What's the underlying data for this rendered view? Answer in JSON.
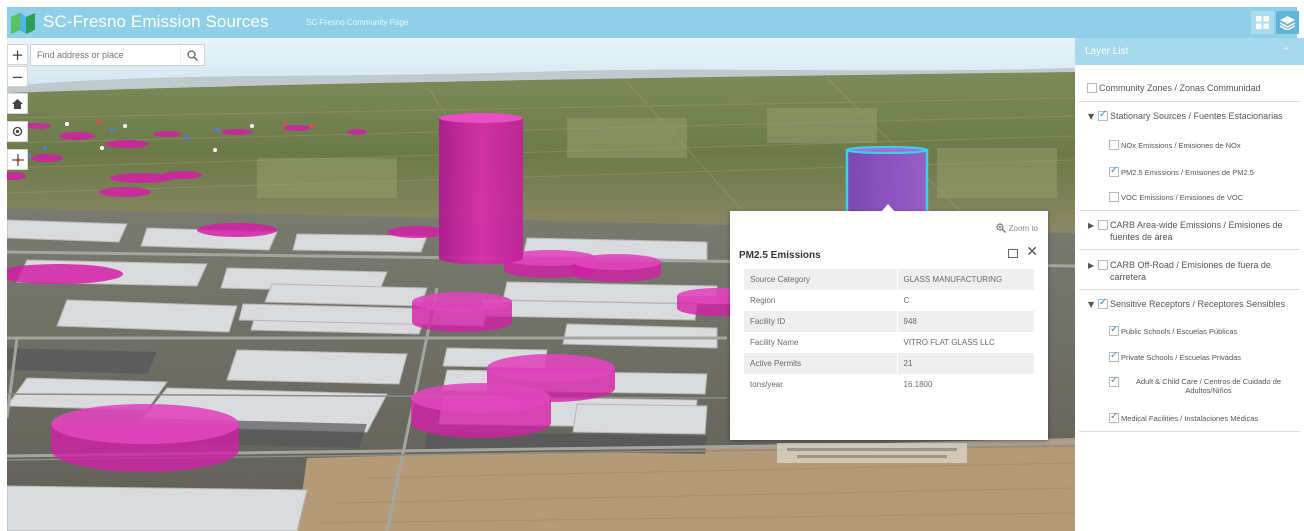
{
  "header": {
    "title": "SC-Fresno Emission Sources",
    "sublink": "SC-Fresno Community Page"
  },
  "map": {
    "search_placeholder": "Find address or place",
    "zoom_in": "+",
    "zoom_out": "−"
  },
  "popup": {
    "zoom_to": "Zoom to",
    "title": "PM2.5 Emissions",
    "rows": [
      {
        "label": "Source Category",
        "value": "GLASS MANUFACTURING"
      },
      {
        "label": "Region",
        "value": "C"
      },
      {
        "label": "Facility ID",
        "value": "948"
      },
      {
        "label": "Facility Name",
        "value": "VITRO FLAT GLASS LLC"
      },
      {
        "label": "Active Permits",
        "value": "21"
      },
      {
        "label": "tons/year",
        "value": "16.1800"
      }
    ]
  },
  "layer_list": {
    "title": "Layer List",
    "layers": {
      "community_zones": {
        "label": "Community Zones / Zonas Communidad",
        "checked": false
      },
      "stationary": {
        "label": "Stationary Sources / Fuentes Estacionarias",
        "checked": true
      },
      "nox": {
        "label": "NOx Emissions / Emisiones de NOx",
        "checked": false
      },
      "pm25": {
        "label": "PM2.5 Emissions / Emisiones de PM2.5",
        "checked": true
      },
      "voc": {
        "label": "VOC Emissions / Emisiones de VOC",
        "checked": false
      },
      "carb_area": {
        "label": "CARB Area-wide Emissions / Emisiones de fuentes de área",
        "checked": false
      },
      "carb_offroad": {
        "label": "CARB Off-Road / Emisiones de fuera de carretera",
        "checked": false
      },
      "sensitive": {
        "label": "Sensitive Receptors / Receptores Sensibles",
        "checked": true
      },
      "public_schools": {
        "label": "Public Schools / Escuelas Públicas",
        "checked": true
      },
      "private_schools": {
        "label": "Private Schools / Escuelas Privadas",
        "checked": true
      },
      "childcare": {
        "label": "Adult & Child Care / Centros de Cuidado de Adultos/Niños",
        "checked": true
      },
      "medical": {
        "label": "Medical Facilities / Instalaciones Médicas",
        "checked": true
      }
    }
  },
  "colors": {
    "header": "#8fd0e8",
    "panel_header": "#a6d9ee",
    "emission_magenta": "#d21fa6",
    "selected_purple": "#8a4fc2",
    "selected_outline": "#35d4f0"
  },
  "icons": [
    "logo-icon",
    "grid-icon",
    "layers-icon",
    "search-icon",
    "home-icon",
    "locate-icon",
    "compass-icon",
    "zoom-to-icon",
    "maximize-icon",
    "close-icon",
    "chevron-up-icon",
    "expand-triangle-icon"
  ]
}
